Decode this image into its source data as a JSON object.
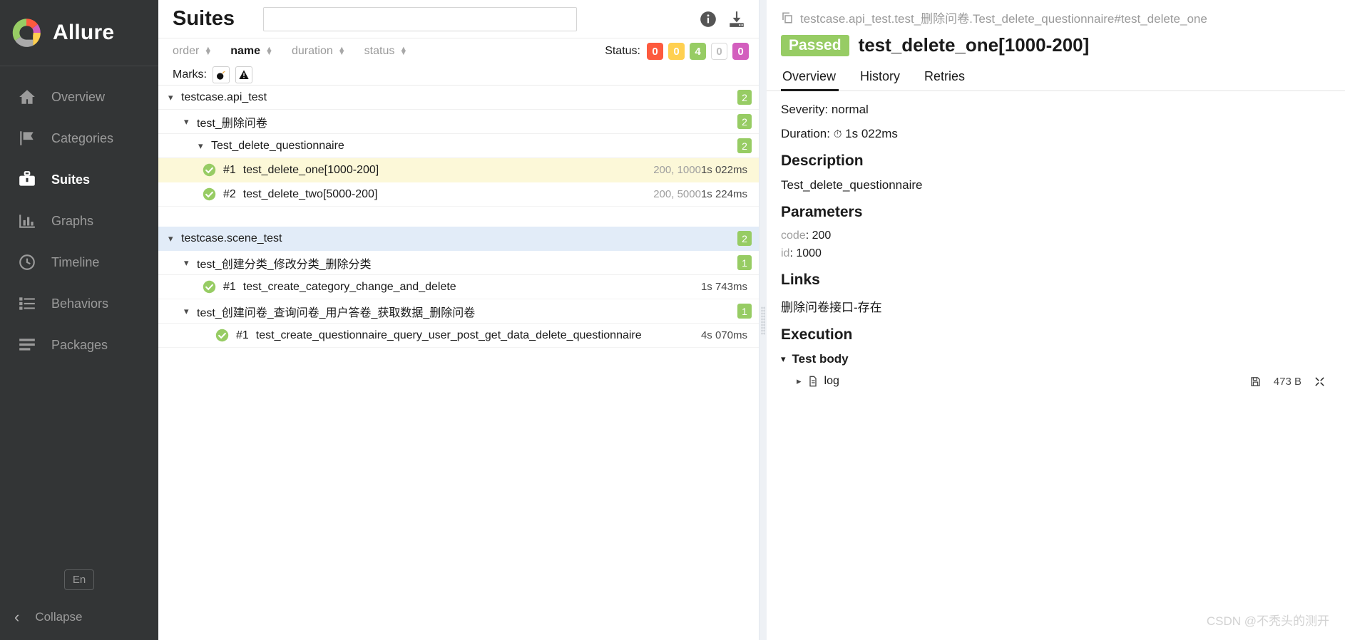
{
  "sidebar": {
    "brand": "Allure",
    "items": [
      {
        "label": "Overview",
        "icon": "home-icon",
        "active": false
      },
      {
        "label": "Categories",
        "icon": "flag-icon",
        "active": false
      },
      {
        "label": "Suites",
        "icon": "suitcase-icon",
        "active": true
      },
      {
        "label": "Graphs",
        "icon": "bar-chart-icon",
        "active": false
      },
      {
        "label": "Timeline",
        "icon": "clock-icon",
        "active": false
      },
      {
        "label": "Behaviors",
        "icon": "list-icon",
        "active": false
      },
      {
        "label": "Packages",
        "icon": "layers-icon",
        "active": false
      }
    ],
    "language_button": "En",
    "collapse_label": "Collapse"
  },
  "center": {
    "title": "Suites",
    "search_placeholder": "",
    "search_value": "",
    "info_icon": "info-icon",
    "download_icon": "download-icon",
    "sort": [
      {
        "label": "order",
        "active": false
      },
      {
        "label": "name",
        "active": true
      },
      {
        "label": "duration",
        "active": false
      },
      {
        "label": "status",
        "active": false
      }
    ],
    "status_label": "Status:",
    "status_counts": [
      {
        "key": "failed",
        "value": "0",
        "color": "#fd5a3e"
      },
      {
        "key": "broken",
        "value": "0",
        "color": "#ffd050"
      },
      {
        "key": "passed",
        "value": "4",
        "color": "#97cc64"
      },
      {
        "key": "skipped",
        "value": "0",
        "color": "#ffffff"
      },
      {
        "key": "unknown",
        "value": "0",
        "color": "#d35ebe"
      }
    ],
    "marks_label": "Marks:",
    "marks": [
      {
        "icon": "bomb-icon"
      },
      {
        "icon": "warning-triangle-icon"
      }
    ]
  },
  "tree": {
    "nodes": [
      {
        "level": 0,
        "type": "group",
        "name": "testcase.api_test",
        "count": "2",
        "highlight": "none"
      },
      {
        "level": 1,
        "type": "group",
        "name": "test_删除问卷",
        "count": "2",
        "highlight": "none"
      },
      {
        "level": 2,
        "type": "group",
        "name": "Test_delete_questionnaire",
        "count": "2",
        "highlight": "none"
      },
      {
        "level": 3,
        "type": "test",
        "num": "#1",
        "name": "test_delete_one[1000-200]",
        "params": "200, 1000",
        "duration": "1s 022ms",
        "status": "passed",
        "highlight": "yellow"
      },
      {
        "level": 3,
        "type": "test",
        "num": "#2",
        "name": "test_delete_two[5000-200]",
        "params": "200, 5000",
        "duration": "1s 224ms",
        "status": "passed",
        "highlight": "none"
      },
      {
        "level": 0,
        "type": "group",
        "name": "testcase.scene_test",
        "count": "2",
        "highlight": "blue"
      },
      {
        "level": 1,
        "type": "group",
        "name": "test_创建分类_修改分类_删除分类",
        "count": "1",
        "highlight": "none"
      },
      {
        "level": 2,
        "type": "test",
        "num": "#1",
        "name": "test_create_category_change_and_delete",
        "params": "",
        "duration": "1s 743ms",
        "status": "passed",
        "highlight": "none"
      },
      {
        "level": 1,
        "type": "group",
        "name": "test_创建问卷_查询问卷_用户答卷_获取数据_删除问卷",
        "count": "1",
        "highlight": "none"
      },
      {
        "level": 2,
        "type": "test",
        "num": "#1",
        "name": "test_create_questionnaire_query_user_post_get_data_delete_questionnaire",
        "params": "",
        "duration": "4s 070ms",
        "status": "passed",
        "highlight": "none"
      }
    ]
  },
  "detail": {
    "breadcrumb": "testcase.api_test.test_删除问卷.Test_delete_questionnaire#test_delete_one",
    "copy_icon": "copy-icon",
    "status_chip": "Passed",
    "title": "test_delete_one[1000-200]",
    "tabs": [
      {
        "label": "Overview",
        "active": true
      },
      {
        "label": "History",
        "active": false
      },
      {
        "label": "Retries",
        "active": false
      }
    ],
    "severity": "Severity: normal",
    "duration_label": "Duration:",
    "duration_value": "1s 022ms",
    "description_heading": "Description",
    "description_text": "Test_delete_questionnaire",
    "parameters_heading": "Parameters",
    "parameters": [
      {
        "key": "code",
        "value": "200"
      },
      {
        "key": "id",
        "value": "1000"
      }
    ],
    "links_heading": "Links",
    "links": [
      "删除问卷接口-存在"
    ],
    "execution_heading": "Execution",
    "test_body_label": "Test body",
    "log_label": "log",
    "log_size": "473 B",
    "attachment_icon": "floppy-save-icon",
    "expand_icon": "expand-icon"
  },
  "watermark": "CSDN @不秃头的测开"
}
